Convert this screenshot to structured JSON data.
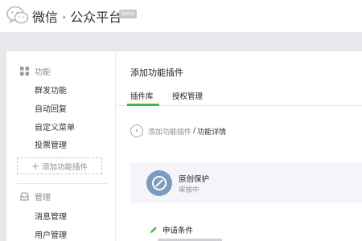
{
  "header": {
    "brand": "微信 · 公众平台",
    "badge": "beta"
  },
  "sidebar": {
    "section_function": "功能",
    "function_items": [
      {
        "label": "群发功能"
      },
      {
        "label": "自动回复"
      },
      {
        "label": "自定义菜单"
      },
      {
        "label": "投票管理"
      }
    ],
    "add_plugin_label": "添加功能插件",
    "section_manage": "管理",
    "manage_items": [
      {
        "label": "消息管理"
      },
      {
        "label": "用户管理"
      }
    ]
  },
  "main": {
    "page_title": "添加功能插件",
    "tabs": [
      {
        "label": "插件库",
        "active": true
      },
      {
        "label": "授权管理",
        "active": false
      }
    ],
    "breadcrumb": {
      "parent": "添加功能插件",
      "separator": "/",
      "current": "功能详情"
    },
    "plugin": {
      "title": "原创保护",
      "status": "审核中",
      "icon": "compass-icon"
    },
    "condition_label": "申请条件"
  },
  "colors": {
    "accent_green": "#44b549",
    "plugin_icon_bg": "#7c9cbf",
    "page_bg": "#e7e8eb"
  }
}
